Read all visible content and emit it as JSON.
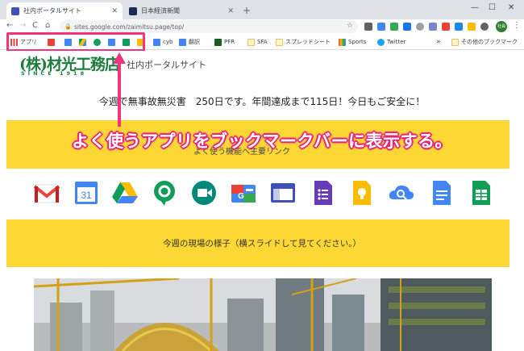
{
  "tabs": [
    {
      "label": "社内ポータルサイト",
      "favicon_color": "#3f51b5"
    },
    {
      "label": "日本経済新聞",
      "favicon_color": "#1a2a5a"
    }
  ],
  "new_tab_symbol": "+",
  "window_controls": {
    "minimize": "—",
    "maximize": "☐",
    "close": "✕"
  },
  "toolbar": {
    "back": "←",
    "forward": "→",
    "reload": "C",
    "home": "⌂",
    "url": "sites.google.com/zaimitsu.page/top/",
    "profile_initials": "社員"
  },
  "bookmarks": {
    "apps_label": "アプリ",
    "icon_only": [
      "gmail-icon",
      "calendar-icon",
      "drive-icon",
      "hangouts-icon",
      "docs-icon",
      "sheets-icon",
      "keep-icon"
    ],
    "cyb": "cyb",
    "translate": "翻訳",
    "pfr": "PFR",
    "sfa": "SFA",
    "spreadsheet": "スプレッドシート",
    "sports": "Sports",
    "twitter": "Twitter",
    "overflow": "»",
    "other": "その他のブックマーク"
  },
  "page": {
    "logo_main": "(株)材光工務店",
    "logo_since": "SINCE 1918",
    "site_title": "社内ポータルサイト",
    "safety_notice": "今週で無事故無災害　250日です。年間達成まで115日！今日もご安全に！",
    "covered_heading": "よく使う機能へ主要リンク",
    "callout": "よく使うアプリをブックマークバーに表示する。",
    "field_heading": "今週の現場の様子（横スライドして見てください。）"
  },
  "apps": [
    "gmail-icon",
    "calendar-icon",
    "drive-icon",
    "hangouts-chat-icon",
    "meet-icon",
    "currents-icon",
    "sites-icon",
    "forms-icon",
    "keep-icon",
    "cloud-search-icon",
    "docs-icon",
    "sheets-icon"
  ],
  "calendar_day": "31",
  "colors": {
    "highlight": "#f0357c",
    "yellow_band": "#fdd835",
    "logo_green": "#1e7d3e"
  }
}
